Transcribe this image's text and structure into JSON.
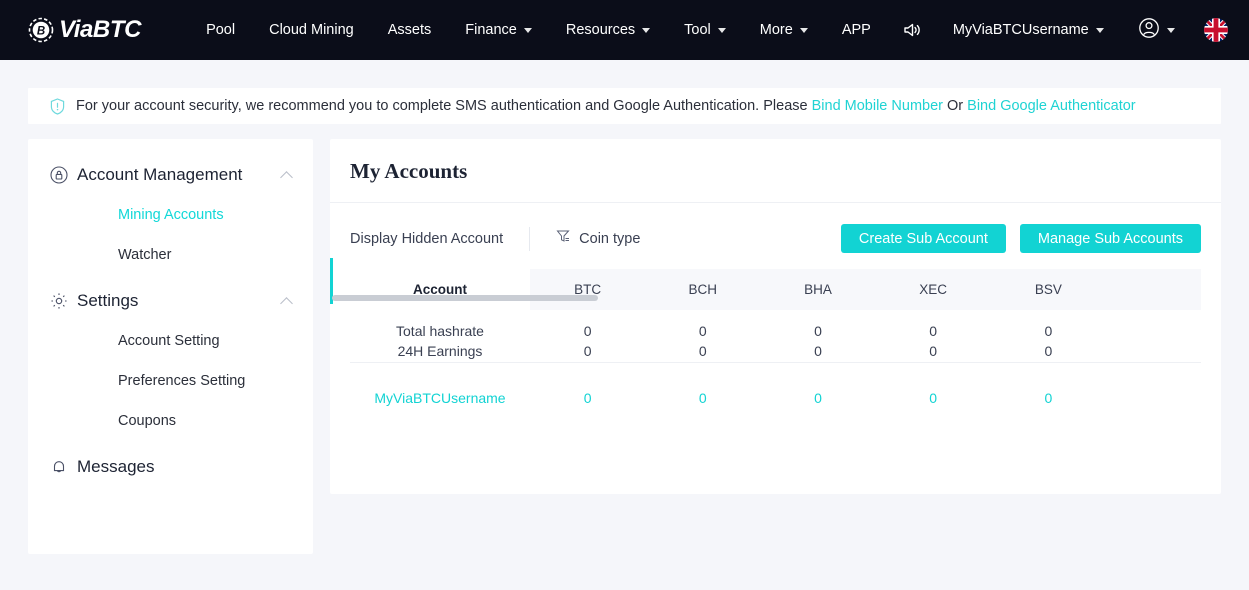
{
  "header": {
    "brand": "ViaBTC",
    "menu_icon": "hamburger-icon",
    "nav": [
      {
        "label": "Pool",
        "has_caret": false
      },
      {
        "label": "Cloud Mining",
        "has_caret": false
      },
      {
        "label": "Assets",
        "has_caret": false
      },
      {
        "label": "Finance",
        "has_caret": true
      },
      {
        "label": "Resources",
        "has_caret": true
      },
      {
        "label": "Tool",
        "has_caret": true
      },
      {
        "label": "More",
        "has_caret": true
      },
      {
        "label": "APP",
        "has_caret": false
      }
    ],
    "announcement_icon": "speaker-icon",
    "username": "MyViaBTCUsername",
    "account_icon": "user-circle-icon",
    "language_icon": "uk-flag-icon"
  },
  "banner": {
    "icon": "shield-warning-icon",
    "text_before": "For your account security, we recommend you to complete SMS authentication and Google Authentication. Please",
    "link_mobile": "Bind Mobile Number",
    "separator": "Or",
    "link_google": "Bind Google Authenticator"
  },
  "sidebar": {
    "groups": [
      {
        "title": "Account Management",
        "icon": "lock-circle-icon",
        "collapse_icon": "chevron-up-icon",
        "items": [
          {
            "label": "Mining Accounts",
            "active": true
          },
          {
            "label": "Watcher",
            "active": false
          }
        ]
      },
      {
        "title": "Settings",
        "icon": "gear-icon",
        "collapse_icon": "chevron-up-icon",
        "items": [
          {
            "label": "Account Setting",
            "active": false
          },
          {
            "label": "Preferences Setting",
            "active": false
          },
          {
            "label": "Coupons",
            "active": false
          }
        ]
      }
    ],
    "messages": {
      "title": "Messages",
      "icon": "bell-icon"
    }
  },
  "main": {
    "title": "My Accounts",
    "toolbar": {
      "display_hidden": "Display Hidden Account",
      "filter_icon": "funnel-filter-icon",
      "coin_type": "Coin type",
      "create_sub_account": "Create Sub Account",
      "manage_sub_accounts": "Manage Sub Accounts"
    },
    "table": {
      "columns": [
        "Account",
        "BTC",
        "BCH",
        "BHA",
        "XEC",
        "BSV"
      ],
      "summary_rows": [
        {
          "label": "Total hashrate",
          "values": [
            "0",
            "0",
            "0",
            "0",
            "0"
          ]
        },
        {
          "label": "24H Earnings",
          "values": [
            "0",
            "0",
            "0",
            "0",
            "0"
          ]
        }
      ],
      "account_rows": [
        {
          "name": "MyViaBTCUsername",
          "values": [
            "0",
            "0",
            "0",
            "0",
            "0"
          ]
        }
      ]
    }
  },
  "colors": {
    "accent": "#12d3d3",
    "header_bg": "#0b0d19",
    "page_bg": "#f5f6fa",
    "text": "#2b2f3a"
  }
}
